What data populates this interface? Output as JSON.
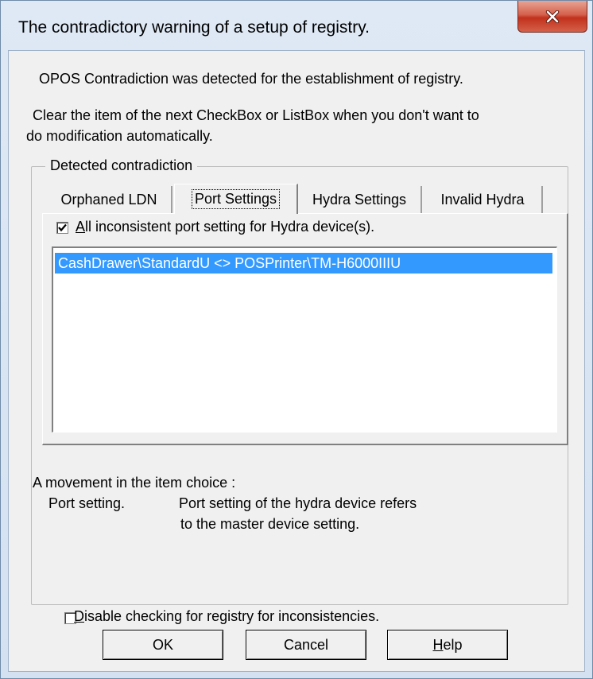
{
  "window": {
    "title": "The contradictory warning of a setup of registry."
  },
  "message": {
    "line1": "OPOS Contradiction was detected for the establishment of registry.",
    "line2": "Clear the item of the next CheckBox or ListBox when you don't want to",
    "line3": "do modification automatically."
  },
  "group": {
    "legend": "Detected contradiction"
  },
  "tabs": [
    {
      "label": "Orphaned LDN"
    },
    {
      "label": "Port Settings"
    },
    {
      "label": "Hydra Settings"
    },
    {
      "label": "Invalid Hydra"
    }
  ],
  "panel": {
    "checkbox_label_first": "A",
    "checkbox_label_rest": "ll inconsistent port setting for Hydra device(s).",
    "checkbox_checked": true,
    "list_items": [
      "CashDrawer\\StandardU <> POSPrinter\\TM-H6000IIIU"
    ]
  },
  "movement": {
    "heading": "A movement in the item choice :",
    "term": "Port setting.",
    "desc1": "Port setting of the hydra device refers",
    "desc2": "to the master device setting."
  },
  "disable_check": {
    "label_first": "D",
    "label_rest": "isable checking for registry for inconsistencies.",
    "checked": false
  },
  "buttons": {
    "ok": "OK",
    "cancel": "Cancel",
    "help_first": "H",
    "help_rest": "elp"
  },
  "colors": {
    "selection": "#3399ff",
    "close_button": "#c2311c"
  }
}
